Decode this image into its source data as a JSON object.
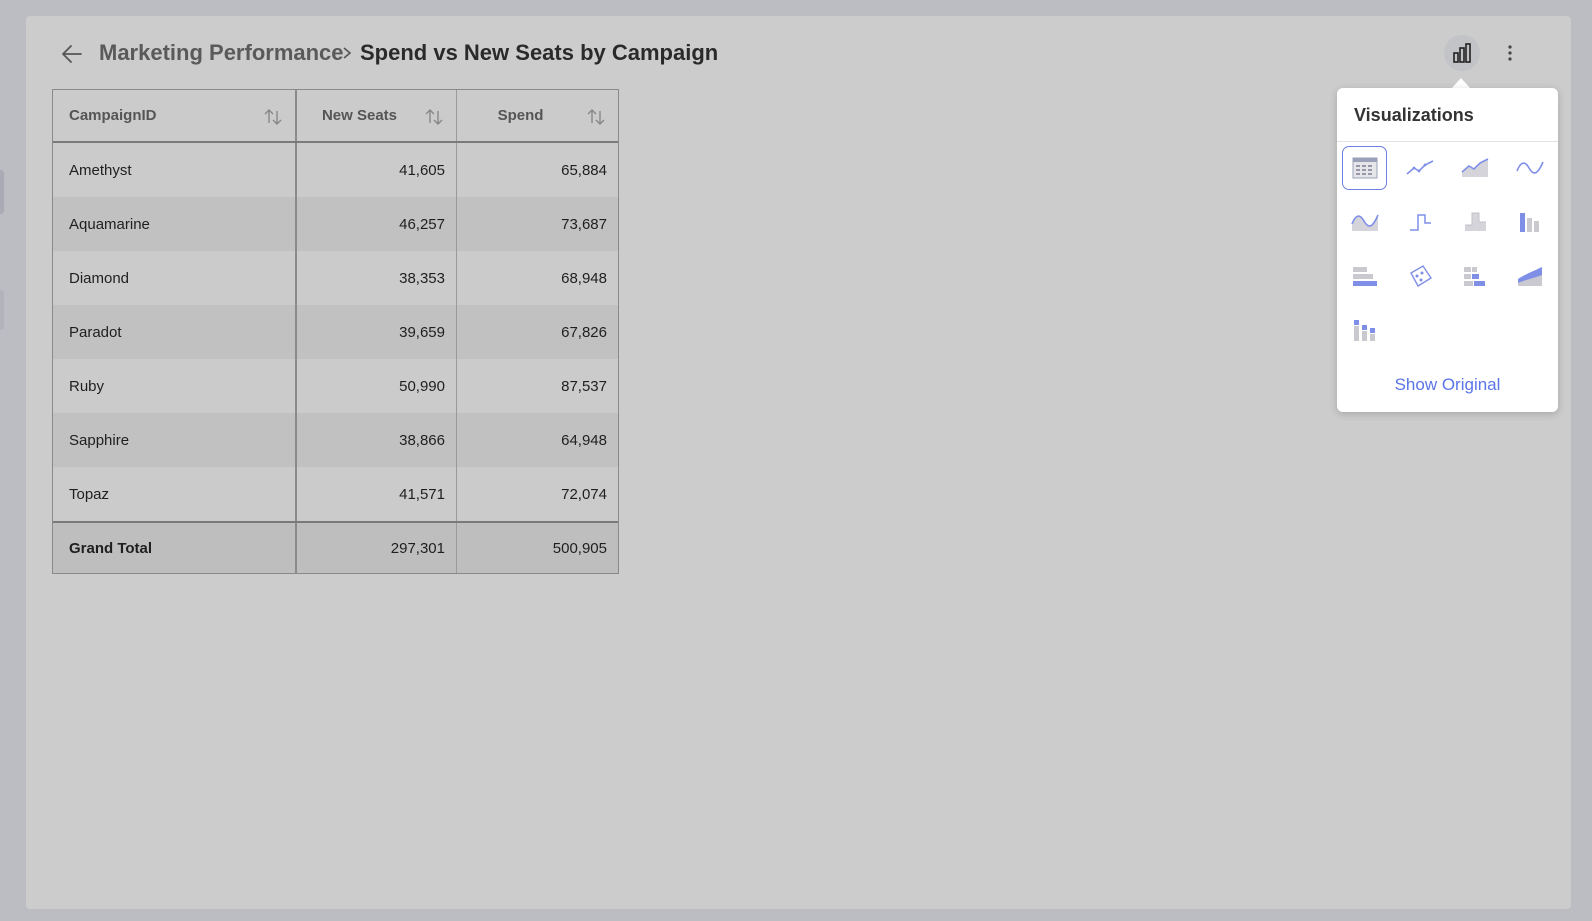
{
  "header": {
    "parent_title": "Marketing Performance",
    "current_title": "Spend vs New Seats by Campaign"
  },
  "table": {
    "columns": [
      "CampaignID",
      "New Seats",
      "Spend"
    ],
    "rows": [
      [
        "Amethyst",
        "41,605",
        "65,884"
      ],
      [
        "Aquamarine",
        "46,257",
        "73,687"
      ],
      [
        "Diamond",
        "38,353",
        "68,948"
      ],
      [
        "Paradot",
        "39,659",
        "67,826"
      ],
      [
        "Ruby",
        "50,990",
        "87,537"
      ],
      [
        "Sapphire",
        "38,866",
        "64,948"
      ],
      [
        "Topaz",
        "41,571",
        "72,074"
      ]
    ],
    "total": [
      "Grand Total",
      "297,301",
      "500,905"
    ]
  },
  "visualizations": {
    "title": "Visualizations",
    "selected": "grid",
    "items": [
      "grid",
      "line",
      "area",
      "spline",
      "spline-area",
      "step-line",
      "step-area",
      "column",
      "bar",
      "scatter",
      "stacked-bar",
      "stacked-area",
      "stacked-column"
    ],
    "show_original_label": "Show Original"
  },
  "colors": {
    "accent": "#5b74e8",
    "icon_blue": "#7f8fe8",
    "icon_gray": "#c9c9cf"
  }
}
